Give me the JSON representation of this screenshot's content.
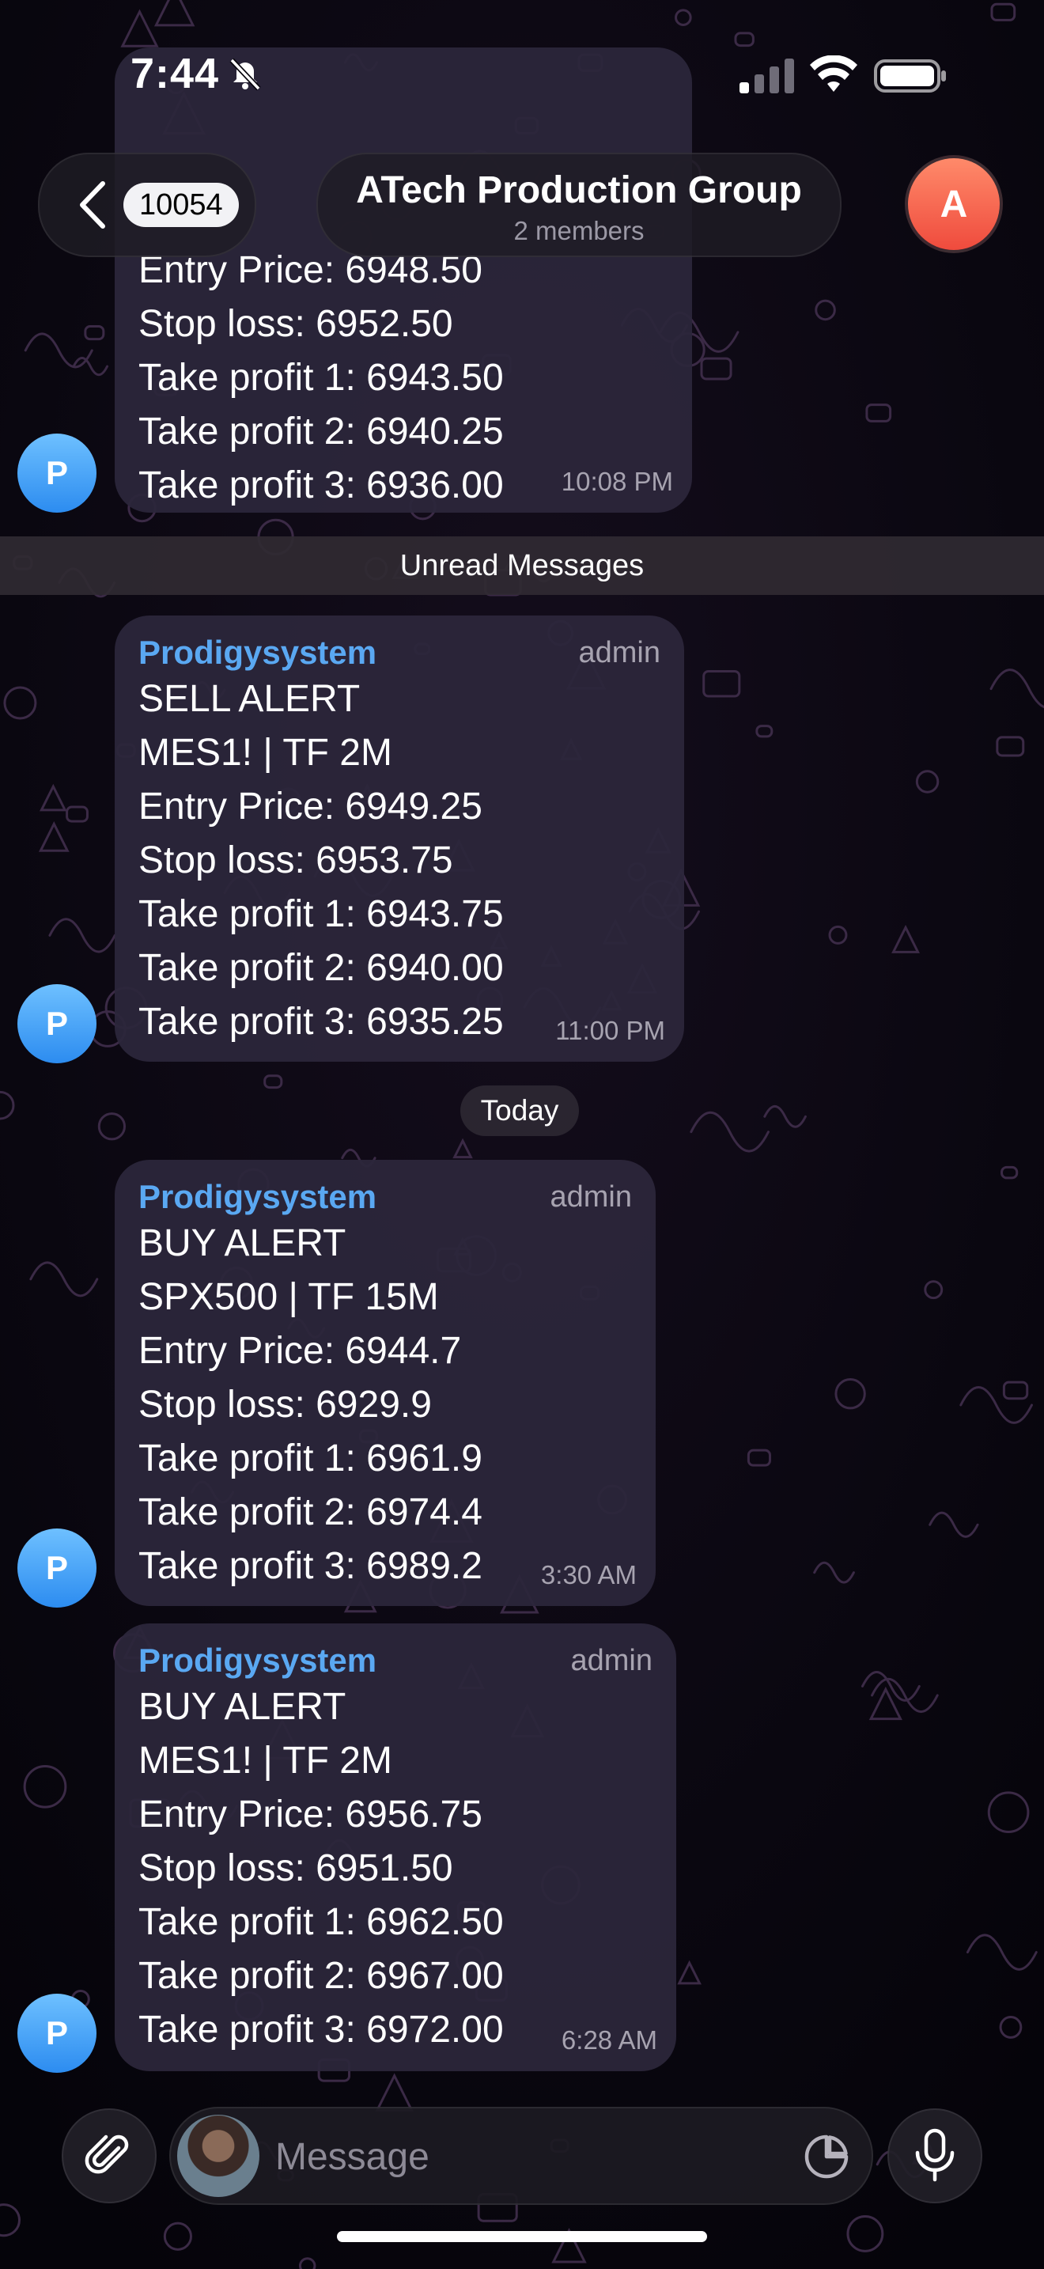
{
  "status_bar": {
    "time": "7:44"
  },
  "header": {
    "unread_count": "10054",
    "group_name": "ATech Production Group",
    "group_subtitle": "2 members",
    "avatar_letter": "A"
  },
  "sender_avatar_letter": "P",
  "messages": [
    {
      "sender": "",
      "role": "",
      "lines": [
        "Entry Price: 6948.50",
        "Stop loss: 6952.50",
        "Take profit 1: 6943.50",
        "Take profit 2: 6940.25",
        "Take profit 3: 6936.00"
      ],
      "time": "10:08 PM"
    },
    {
      "sender": "Prodigysystem",
      "role": "admin",
      "lines": [
        "SELL ALERT",
        "MES1! | TF 2M",
        "Entry Price: 6949.25",
        "Stop loss: 6953.75",
        "Take profit 1: 6943.75",
        "Take profit 2: 6940.00",
        "Take profit 3: 6935.25"
      ],
      "time": "11:00 PM"
    },
    {
      "sender": "Prodigysystem",
      "role": "admin",
      "lines": [
        "BUY ALERT",
        "SPX500 | TF 15M",
        "Entry Price: 6944.7",
        "Stop loss: 6929.9",
        "Take profit 1: 6961.9",
        "Take profit 2: 6974.4",
        "Take profit 3: 6989.2"
      ],
      "time": "3:30 AM"
    },
    {
      "sender": "Prodigysystem",
      "role": "admin",
      "lines": [
        "BUY ALERT",
        "MES1! | TF 2M",
        "Entry Price: 6956.75",
        "Stop loss: 6951.50",
        "Take profit 1: 6962.50",
        "Take profit 2: 6967.00",
        "Take profit 3: 6972.00"
      ],
      "time": "6:28 AM"
    }
  ],
  "separators": {
    "unread": "Unread Messages",
    "today": "Today"
  },
  "composer": {
    "placeholder": "Message"
  },
  "colors": {
    "sender_name": "#5aa8f2",
    "bubble": "#2c263a",
    "accent_avatar": "#2c8cf0"
  },
  "icons": [
    "bell-slash-icon",
    "signal-icon",
    "wifi-icon",
    "battery-icon",
    "chevron-left-icon",
    "paperclip-icon",
    "sticker-icon",
    "microphone-icon"
  ]
}
